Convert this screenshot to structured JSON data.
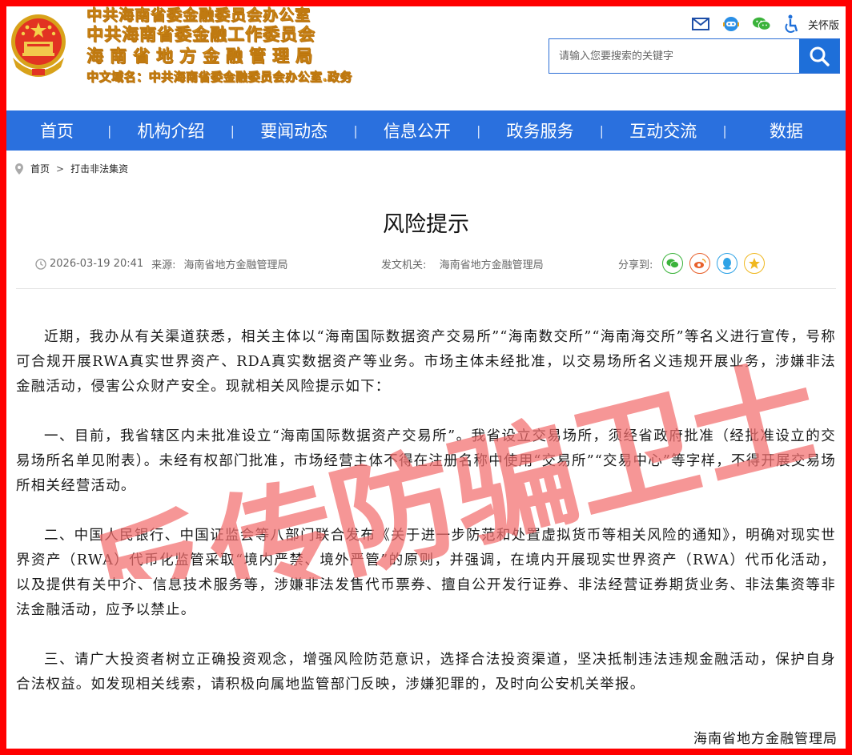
{
  "header": {
    "titles": [
      "中共海南省委金融委员会办公室",
      "中共海南省委金融工作委员会",
      "海南省地方金融管理局",
      "中文域名：中共海南省委金融委员会办公室.政务"
    ],
    "tools": {
      "icons": [
        "mail-icon",
        "robot-service-icon",
        "wechat-icon",
        "accessibility-icon"
      ],
      "care_label": "关怀版"
    },
    "search": {
      "placeholder": "请输入您要搜索的关键字"
    }
  },
  "nav": {
    "items": [
      "首页",
      "机构介绍",
      "要闻动态",
      "信息公开",
      "政务服务",
      "互动交流",
      "数据"
    ],
    "separator": "|"
  },
  "breadcrumb": {
    "home": "首页",
    "sep": ">",
    "current": "打击非法集资"
  },
  "article": {
    "title": "风险提示",
    "date": "2026-03-19 20:41",
    "source_label": "来源:",
    "source": "海南省地方金融管理局",
    "issuer_label": "发文机关:",
    "issuer": "海南省地方金融管理局",
    "share_label": "分享到:",
    "share_icons": [
      "wechat-share-icon",
      "weibo-share-icon",
      "qq-share-icon",
      "qzone-share-icon"
    ],
    "paragraphs": [
      "近期，我办从有关渠道获悉，相关主体以“海南国际数据资产交易所”“海南数交所”“海南海交所”等名义进行宣传，号称可合规开展RWA真实世界资产、RDA真实数据资产等业务。市场主体未经批准，以交易场所名义违规开展业务，涉嫌非法金融活动，侵害公众财产安全。现就相关风险提示如下：",
      "一、目前，我省辖区内未批准设立“海南国际数据资产交易所”。我省设立交易场所，须经省政府批准（经批准设立的交易场所名单见附表）。未经有权部门批准，市场经营主体不得在注册名称中使用“交易所”“交易中心”等字样，不得开展交易场所相关经营活动。",
      "二、中国人民银行、中国证监会等八部门联合发布《关于进一步防范和处置虚拟货币等相关风险的通知》，明确对现实世界资产（RWA）代币化监管采取“境内严禁、境外严管”的原则，并强调，在境内开展现实世界资产（RWA）代币化活动，以及提供有关中介、信息技术服务等，涉嫌非法发售代币票券、擅自公开发行证券、非法经营证券期货业务、非法集资等非法金融活动，应予以禁止。",
      "三、请广大投资者树立正确投资观念，增强风险防范意识，选择合法投资渠道，坚决抵制违法违规金融活动，保护自身合法权益。如发现相关线索，请积极向属地监管部门反映，涉嫌犯罪的，及时向公安机关举报。"
    ],
    "signature": "海南省地方金融管理局"
  },
  "watermark": {
    "text": "反传防骗卫士",
    "color": "#f26d6d"
  },
  "colors": {
    "border": "#ff0000",
    "nav": "#2a70de",
    "title_gold": "#f0b230"
  }
}
